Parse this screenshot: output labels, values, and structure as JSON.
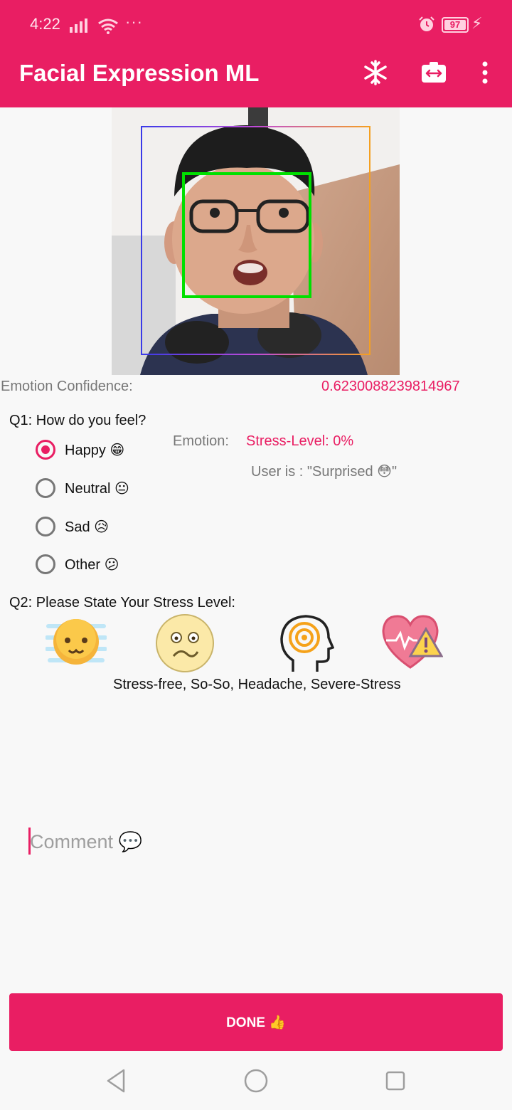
{
  "status_bar": {
    "time": "4:22",
    "overflow": "···",
    "battery": "97"
  },
  "app_bar": {
    "title": "Facial Expression ML",
    "actions": [
      "snowflake-icon",
      "switch-camera-icon",
      "more-vert-icon"
    ]
  },
  "confidence": {
    "label": "Emotion Confidence:",
    "value": "0.6230088239814967"
  },
  "q1": {
    "question": "Q1: How do you feel?",
    "options": [
      {
        "label": "Happy 😁",
        "selected": true
      },
      {
        "label": "Neutral 😐",
        "selected": false
      },
      {
        "label": "Sad 😥",
        "selected": false
      },
      {
        "label": "Other 😕",
        "selected": false
      }
    ]
  },
  "result": {
    "emotion_label": "Emotion:",
    "stress_level": "Stress-Level: 0%",
    "user_is": "User is :  \"Surprised 😳\""
  },
  "q2": {
    "question": "Q2: Please State Your Stress Level:",
    "levels_text": "Stress-free, So-So, Headache, Severe-Stress",
    "icons": [
      "stress-free-icon",
      "so-so-icon",
      "headache-icon",
      "severe-stress-icon"
    ]
  },
  "comment": {
    "placeholder": "Comment 💬"
  },
  "done_button": {
    "label": "DONE 👍"
  },
  "colors": {
    "accent": "#e91e63",
    "face_box": "#00e000"
  }
}
